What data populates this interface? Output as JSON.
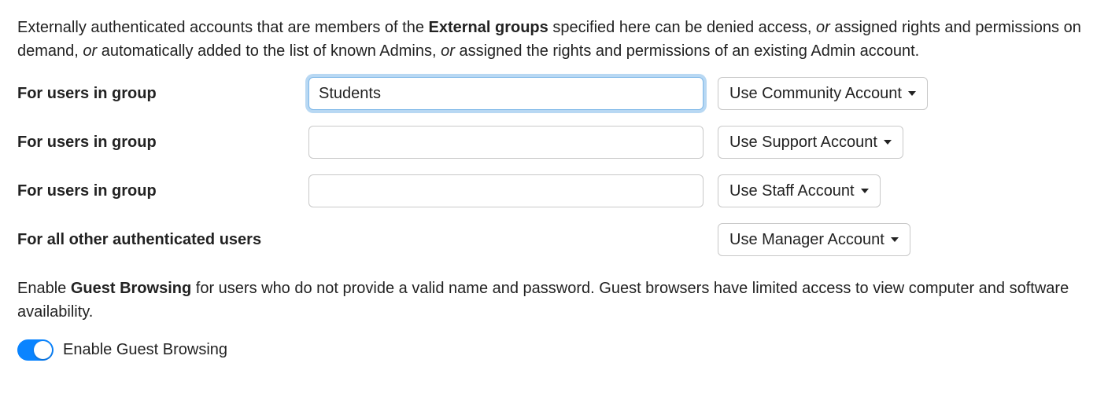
{
  "intro": {
    "seg1": "Externally authenticated accounts that are members of the ",
    "bold1": "External groups",
    "seg2": " specified here can be denied access, ",
    "ital1": "or",
    "seg3": " assigned rights and permissions on demand, ",
    "ital2": "or",
    "seg4": " automatically added to the list of known Admins, ",
    "ital3": "or",
    "seg5": " assigned the rights and permissions of an existing Admin account."
  },
  "rows": [
    {
      "label": "For users in group",
      "input": "Students",
      "dropdown": "Use Community Account",
      "focused": true
    },
    {
      "label": "For users in group",
      "input": "",
      "dropdown": "Use Support Account",
      "focused": false
    },
    {
      "label": "For users in group",
      "input": "",
      "dropdown": "Use Staff Account",
      "focused": false
    }
  ],
  "other": {
    "label": "For all other authenticated users",
    "dropdown": "Use Manager Account"
  },
  "guest": {
    "seg1": "Enable ",
    "bold1": "Guest Browsing",
    "seg2": " for users who do not provide a valid name and password. Guest browsers have limited access to view computer and software availability."
  },
  "toggle": {
    "label": "Enable Guest Browsing",
    "on": true
  }
}
